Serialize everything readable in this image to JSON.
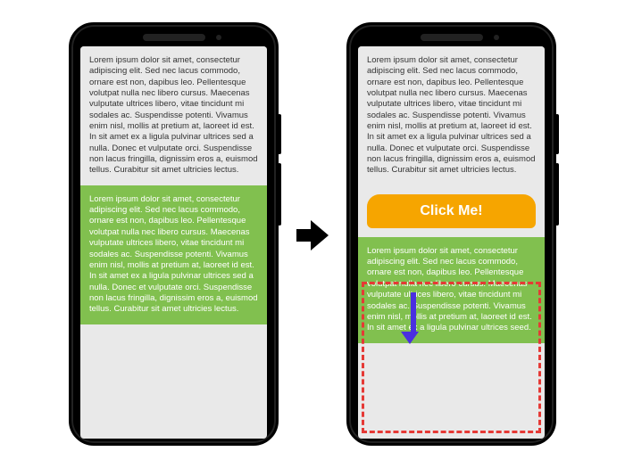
{
  "left_phone": {
    "top_paragraph": "Lorem ipsum dolor sit amet, consectetur adipiscing elit. Sed nec lacus commodo, ornare est non, dapibus leo. Pellentesque volutpat nulla nec libero cursus. Maecenas vulputate ultrices libero, vitae tincidunt mi sodales ac. Suspendisse potenti. Vivamus enim nisl, mollis at pretium at, laoreet id est. In sit amet ex a ligula pulvinar ultrices sed a nulla. Donec et vulputate orci. Suspendisse non lacus fringilla, dignissim eros a, euismod tellus. Curabitur sit amet ultricies lectus.",
    "bottom_paragraph": "Lorem ipsum dolor sit amet, consectetur adipiscing elit. Sed nec lacus commodo, ornare est non, dapibus leo. Pellentesque volutpat nulla nec libero cursus. Maecenas vulputate ultrices libero, vitae tincidunt mi sodales ac. Suspendisse potenti. Vivamus enim nisl, mollis at pretium at, laoreet id est. In sit amet ex a ligula pulvinar ultrices sed a nulla. Donec et vulputate orci. Suspendisse non lacus fringilla, dignissim eros a, euismod tellus. Curabitur sit amet ultricies lectus."
  },
  "right_phone": {
    "top_paragraph": "Lorem ipsum dolor sit amet, consectetur adipiscing elit. Sed nec lacus commodo, ornare est non, dapibus leo. Pellentesque volutpat nulla nec libero cursus. Maecenas vulputate ultrices libero, vitae tincidunt mi sodales ac. Suspendisse potenti. Vivamus enim nisl, mollis at pretium at, laoreet id est. In sit amet ex a ligula pulvinar ultrices sed a nulla. Donec et vulputate orci. Suspendisse non lacus fringilla, dignissim eros a, euismod tellus. Curabitur sit amet ultricies lectus.",
    "banner_label": "Click Me!",
    "bottom_paragraph": "Lorem ipsum dolor sit amet, consectetur adipiscing elit. Sed nec lacus commodo, ornare est non, dapibus leo. Pellentesque volutpat nulla nec libero cursus. Maecenas vulputate ultrices libero, vitae tincidunt mi sodales ac. Suspendisse potenti. Vivamus enim nisl, mollis at pretium at, laoreet id est. In sit amet ex a ligula pulvinar ultrices seed."
  }
}
